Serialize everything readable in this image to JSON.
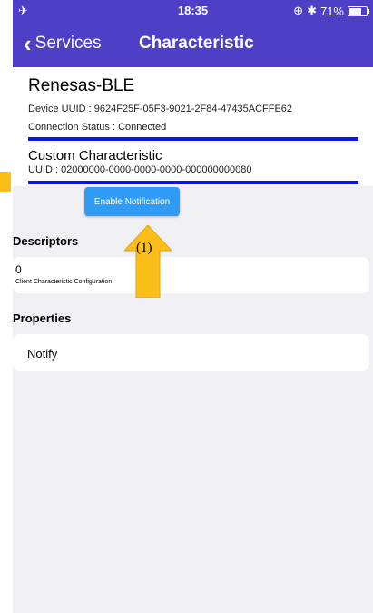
{
  "status_bar": {
    "time": "18:35",
    "battery": "71%",
    "battery_level": 0.71
  },
  "nav": {
    "back_label": "Services",
    "title": "Characteristic"
  },
  "device": {
    "name": "Renesas-BLE",
    "uuid_label": "Device UUID :",
    "uuid": "9624F25F-05F3-9021-2F84-47435ACFFE62",
    "connection_label": "Connection Status :",
    "connection_status": "Connected"
  },
  "characteristic": {
    "name": "Custom Characteristic",
    "uuid_label": "UUID :",
    "uuid": "02000000-0000-0000-0000-000000000080"
  },
  "enable_button": {
    "label": "Enable Notification"
  },
  "descriptors": {
    "header": "Descriptors",
    "items": [
      {
        "value": "0",
        "name": "Client Characteristic Configuration"
      }
    ]
  },
  "properties": {
    "header": "Properties",
    "items": [
      {
        "name": "Notify"
      }
    ]
  },
  "annotation": {
    "label": "(1)"
  },
  "colors": {
    "nav_bg": "#4f3ec6",
    "accent_bar": "#0a15e6",
    "button": "#2f9df7",
    "annotation_arrow": "#fbbd18"
  }
}
